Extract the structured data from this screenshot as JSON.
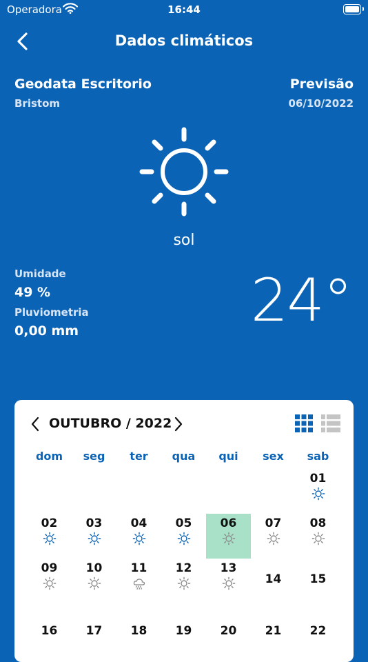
{
  "status": {
    "carrier": "Operadora",
    "time": "16:44"
  },
  "nav": {
    "title": "Dados climáticos",
    "back_icon": "chevron-left-icon"
  },
  "location": {
    "name": "Geodata Escritorio",
    "city": "Bristom"
  },
  "forecast": {
    "label": "Previsão",
    "date": "06/10/2022"
  },
  "weather": {
    "condition": "sol",
    "icon": "sun-icon",
    "humidity_label": "Umidade",
    "humidity": "49 %",
    "rain_label": "Pluviometria",
    "rain": "0,00 mm",
    "temperature": "24°"
  },
  "calendar": {
    "month_title": "OUTUBRO / 2022",
    "weekdays": [
      "dom",
      "seg",
      "ter",
      "qua",
      "qui",
      "sex",
      "sab"
    ],
    "selected_day": "06",
    "colors": {
      "accent": "#0b63b6",
      "selected": "#a8e0c8",
      "past_icon": "#8a8a8a"
    },
    "weeks": [
      [
        null,
        null,
        null,
        null,
        null,
        null,
        {
          "day": "01",
          "icon": "sun-icon",
          "tone": "blue"
        }
      ],
      [
        {
          "day": "02",
          "icon": "sun-icon",
          "tone": "blue"
        },
        {
          "day": "03",
          "icon": "sun-icon",
          "tone": "blue"
        },
        {
          "day": "04",
          "icon": "sun-icon",
          "tone": "blue"
        },
        {
          "day": "05",
          "icon": "sun-icon",
          "tone": "blue"
        },
        {
          "day": "06",
          "icon": "sun-icon",
          "tone": "gray"
        },
        {
          "day": "07",
          "icon": "sun-icon",
          "tone": "gray"
        },
        {
          "day": "08",
          "icon": "sun-icon",
          "tone": "gray"
        }
      ],
      [
        {
          "day": "09",
          "icon": "sun-icon",
          "tone": "gray"
        },
        {
          "day": "10",
          "icon": "sun-icon",
          "tone": "gray"
        },
        {
          "day": "11",
          "icon": "rain-cloud-icon",
          "tone": "gray"
        },
        {
          "day": "12",
          "icon": "sun-icon",
          "tone": "gray"
        },
        {
          "day": "13",
          "icon": "sun-icon",
          "tone": "gray"
        },
        {
          "day": "14",
          "icon": null,
          "tone": null
        },
        {
          "day": "15",
          "icon": null,
          "tone": null
        }
      ],
      [
        {
          "day": "16",
          "icon": null,
          "tone": null
        },
        {
          "day": "17",
          "icon": null,
          "tone": null
        },
        {
          "day": "18",
          "icon": null,
          "tone": null
        },
        {
          "day": "19",
          "icon": null,
          "tone": null
        },
        {
          "day": "20",
          "icon": null,
          "tone": null
        },
        {
          "day": "21",
          "icon": null,
          "tone": null
        },
        {
          "day": "22",
          "icon": null,
          "tone": null
        }
      ]
    ]
  }
}
